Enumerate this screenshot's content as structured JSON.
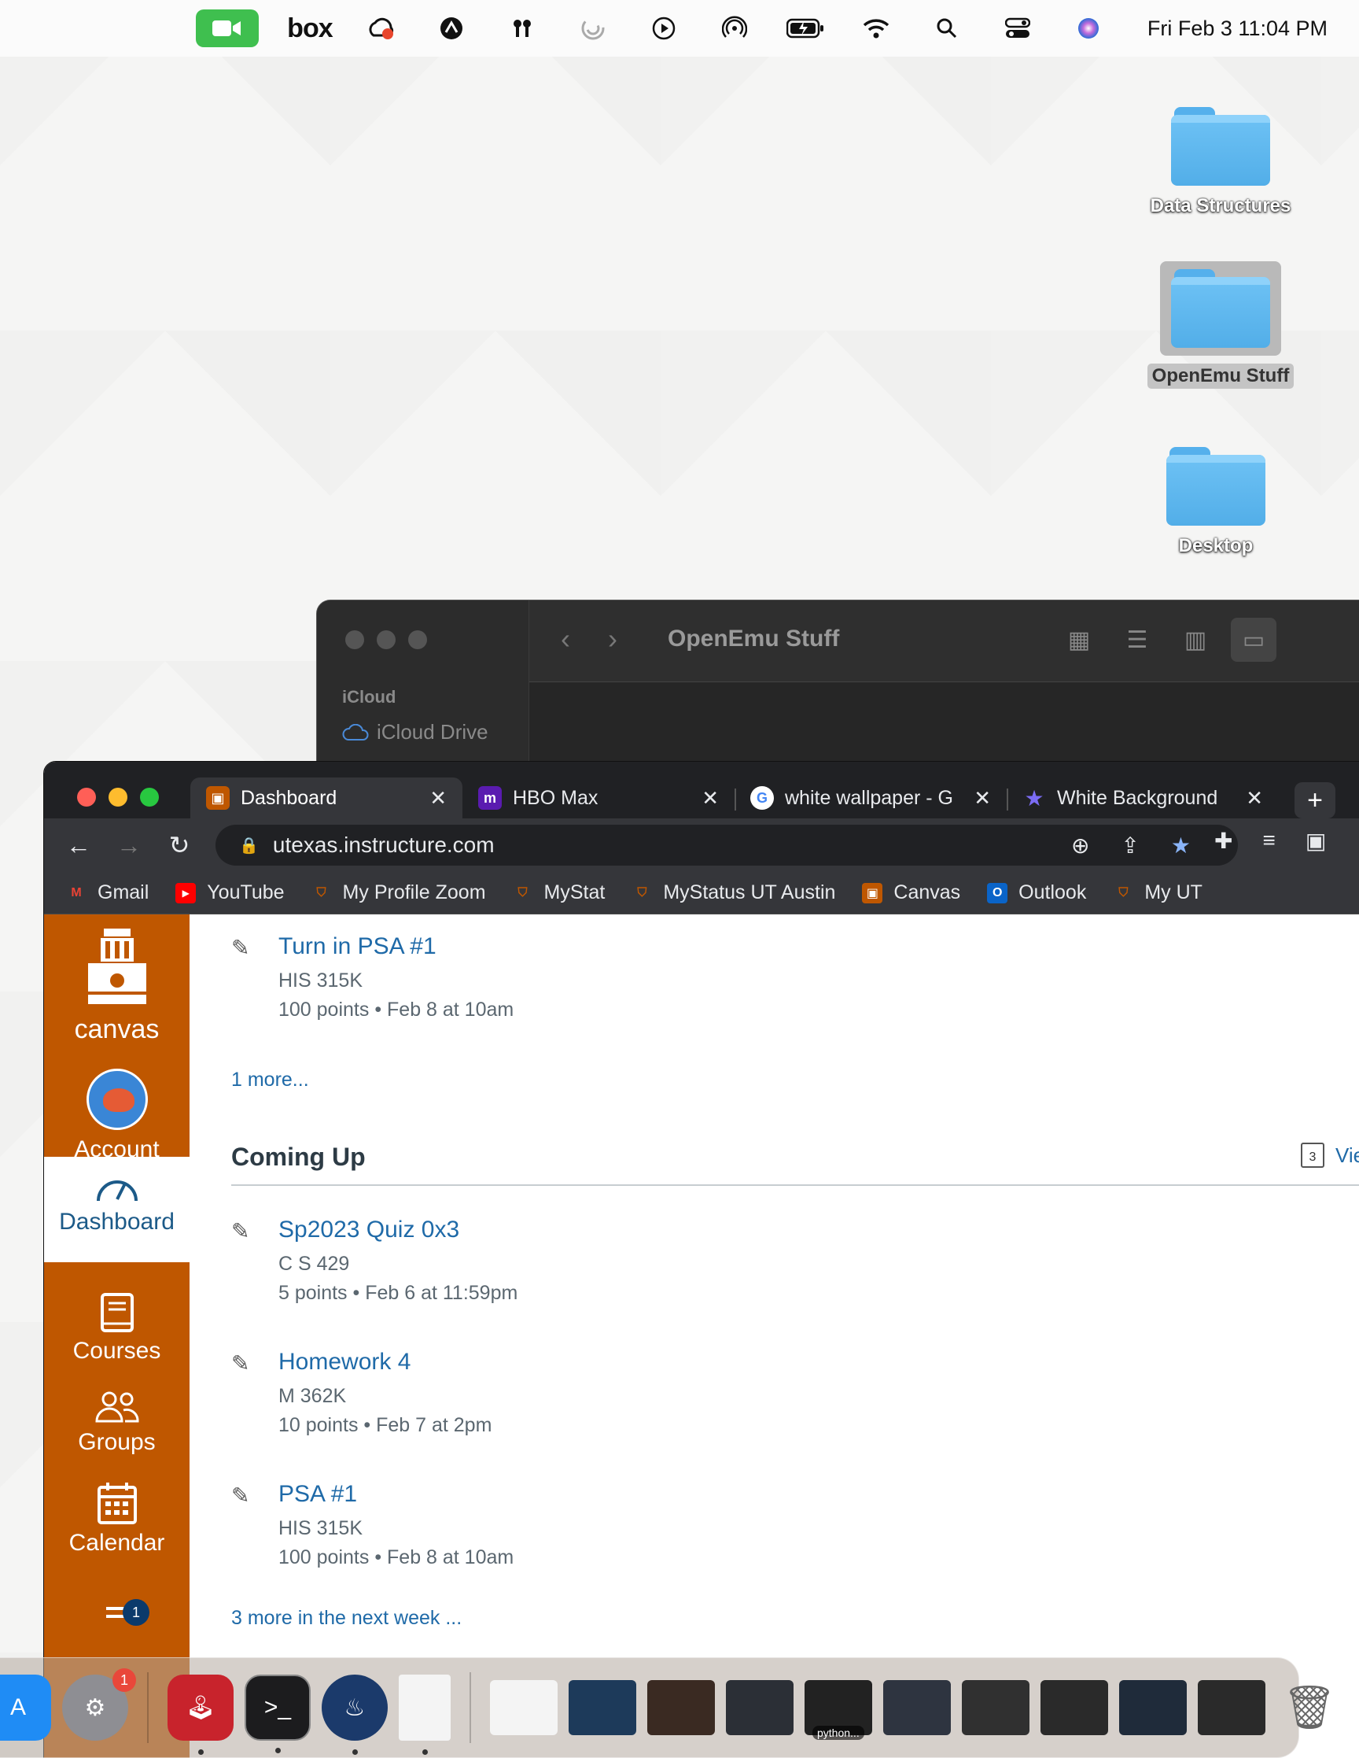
{
  "menubar": {
    "icons": [
      "facetime-icon",
      "box-icon",
      "creative-cloud-icon",
      "logi-icon",
      "airpods-icon",
      "loading-icon",
      "play-icon",
      "airdrop-icon",
      "battery-icon",
      "wifi-icon",
      "search-icon",
      "control-center-icon",
      "siri-icon"
    ],
    "box_label": "box",
    "clock": "Fri Feb 3  11:04 PM"
  },
  "desktop": {
    "items": [
      {
        "label": "Data Structures",
        "selected": false
      },
      {
        "label": "OpenEmu Stuff",
        "selected": true
      },
      {
        "label": "Desktop",
        "selected": false
      }
    ]
  },
  "finder": {
    "title": "OpenEmu Stuff",
    "sidebar_section": "iCloud",
    "sidebar_item": "iCloud Drive"
  },
  "chrome": {
    "tabs": [
      {
        "title": "Dashboard",
        "favicon": "canvas-icon",
        "active": true
      },
      {
        "title": "HBO Max",
        "favicon": "hbo-max-icon",
        "active": false
      },
      {
        "title": "white wallpaper - G",
        "favicon": "google-icon",
        "active": false
      },
      {
        "title": "White Background",
        "favicon": "star-icon",
        "active": false
      }
    ],
    "url": "utexas.instructure.com",
    "bookmarks": [
      {
        "label": "Gmail",
        "icon": "gmail-icon"
      },
      {
        "label": "YouTube",
        "icon": "youtube-icon"
      },
      {
        "label": "My Profile Zoom",
        "icon": "ut-shield-icon"
      },
      {
        "label": "MyStat",
        "icon": "ut-shield-icon"
      },
      {
        "label": "MyStatus UT Austin",
        "icon": "ut-shield-icon"
      },
      {
        "label": "Canvas",
        "icon": "canvas-icon"
      },
      {
        "label": "Outlook",
        "icon": "outlook-icon"
      },
      {
        "label": "My UT",
        "icon": "ut-shield-icon"
      }
    ]
  },
  "canvas": {
    "logo_text": "canvas",
    "nav": {
      "account": "Account",
      "dashboard": "Dashboard",
      "courses": "Courses",
      "groups": "Groups",
      "calendar": "Calendar",
      "inbox_badge": "1"
    },
    "todo": [
      {
        "title": "Turn in PSA #1",
        "course": "HIS 315K",
        "meta": "100 points • Feb 8 at 10am"
      }
    ],
    "todo_more": "1 more...",
    "coming_up": {
      "heading": "Coming Up",
      "view_calendar": "View C",
      "calendar_day": "3",
      "items": [
        {
          "title": "Sp2023 Quiz 0x3",
          "course": "C S 429",
          "meta": "5 points • Feb 6 at 11:59pm"
        },
        {
          "title": "Homework 4",
          "course": "M 362K",
          "meta": "10 points • Feb 7 at 2pm"
        },
        {
          "title": "PSA #1",
          "course": "HIS 315K",
          "meta": "100 points • Feb 8 at 10am"
        }
      ],
      "more": "3 more in the next week ..."
    }
  },
  "dock": {
    "settings_badge": "1",
    "python_caption": "python..."
  }
}
